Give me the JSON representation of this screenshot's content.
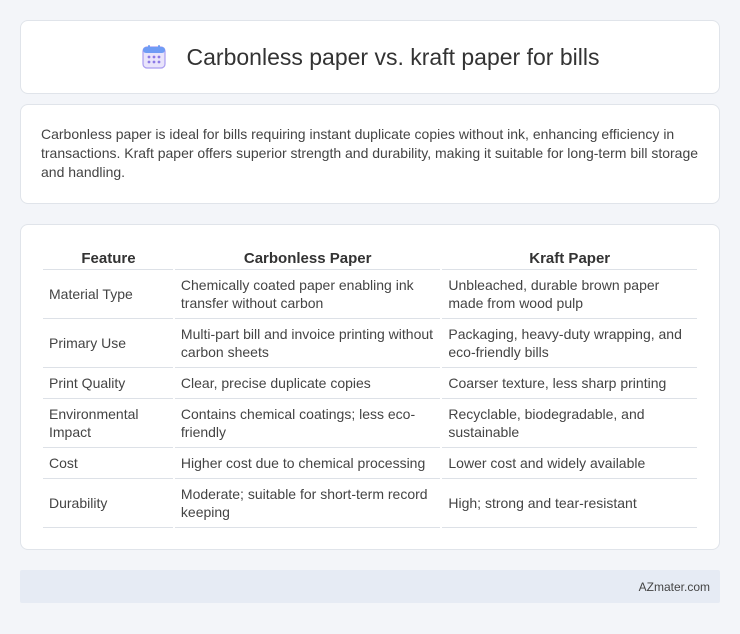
{
  "header": {
    "title": "Carbonless paper vs. kraft paper for bills",
    "icon": "calendar-icon"
  },
  "summary": {
    "text": "Carbonless paper is ideal for bills requiring instant duplicate copies without ink, enhancing efficiency in transactions. Kraft paper offers superior strength and durability, making it suitable for long-term bill storage and handling."
  },
  "table": {
    "headers": [
      "Feature",
      "Carbonless Paper",
      "Kraft Paper"
    ],
    "rows": [
      [
        "Material Type",
        "Chemically coated paper enabling ink transfer without carbon",
        "Unbleached, durable brown paper made from wood pulp"
      ],
      [
        "Primary Use",
        "Multi-part bill and invoice printing without carbon sheets",
        "Packaging, heavy-duty wrapping, and eco-friendly bills"
      ],
      [
        "Print Quality",
        "Clear, precise duplicate copies",
        "Coarser texture, less sharp printing"
      ],
      [
        "Environmental Impact",
        "Contains chemical coatings; less eco-friendly",
        "Recyclable, biodegradable, and sustainable"
      ],
      [
        "Cost",
        "Higher cost due to chemical processing",
        "Lower cost and widely available"
      ],
      [
        "Durability",
        "Moderate; suitable for short-term record keeping",
        "High; strong and tear-resistant"
      ]
    ]
  },
  "footer": {
    "text": "AZmater.com"
  },
  "colors": {
    "background": "#f3f5f9",
    "card": "#ffffff",
    "footer_bg": "#e6ebf4",
    "icon_blue": "#5b8def",
    "icon_purple": "#8c7ae6"
  }
}
